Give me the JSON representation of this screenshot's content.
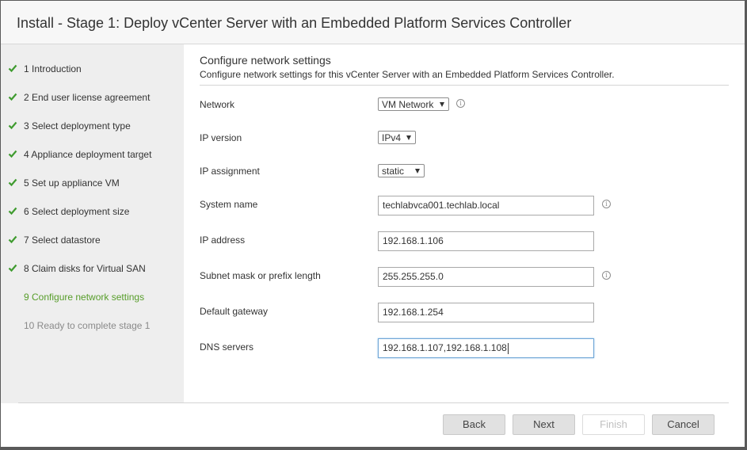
{
  "window": {
    "title": "Install - Stage 1: Deploy vCenter Server with an Embedded Platform Services Controller"
  },
  "sidebar": {
    "steps": [
      {
        "label": "1 Introduction",
        "status": "complete",
        "icon": "check-icon"
      },
      {
        "label": "2 End user license agreement",
        "status": "complete",
        "icon": "check-icon"
      },
      {
        "label": "3 Select deployment type",
        "status": "complete",
        "icon": "check-icon"
      },
      {
        "label": "4 Appliance deployment target",
        "status": "complete",
        "icon": "check-icon"
      },
      {
        "label": "5 Set up appliance VM",
        "status": "complete",
        "icon": "check-icon"
      },
      {
        "label": "6 Select deployment size",
        "status": "complete",
        "icon": "check-icon"
      },
      {
        "label": "7 Select datastore",
        "status": "complete",
        "icon": "check-icon"
      },
      {
        "label": "8 Claim disks for Virtual SAN",
        "status": "complete",
        "icon": "check-icon"
      },
      {
        "label": "9 Configure network settings",
        "status": "active"
      },
      {
        "label": "10 Ready to complete stage 1",
        "status": "pending"
      }
    ]
  },
  "main": {
    "heading": "Configure network settings",
    "description": "Configure network settings for this vCenter Server with an Embedded Platform Services Controller.",
    "fields": {
      "network": {
        "label": "Network",
        "value": "VM Network",
        "icon": "info-icon"
      },
      "ip_version": {
        "label": "IP version",
        "value": "IPv4"
      },
      "ip_assignment": {
        "label": "IP assignment",
        "value": "static"
      },
      "system_name": {
        "label": "System name",
        "value": "techlabvca001.techlab.local",
        "icon": "info-icon"
      },
      "ip_address": {
        "label": "IP address",
        "value": "192.168.1.106"
      },
      "subnet_mask": {
        "label": "Subnet mask or prefix length",
        "value": "255.255.255.0",
        "icon": "info-icon"
      },
      "default_gateway": {
        "label": "Default gateway",
        "value": "192.168.1.254"
      },
      "dns_servers": {
        "label": "DNS servers",
        "value": "192.168.1.107,192.168.1.108"
      }
    }
  },
  "footer": {
    "back_label": "Back",
    "next_label": "Next",
    "finish_label": "Finish",
    "cancel_label": "Cancel"
  },
  "colors": {
    "check": "#3f9b2f",
    "active_step": "#579d2a",
    "focus_border": "#6fa6d6"
  }
}
